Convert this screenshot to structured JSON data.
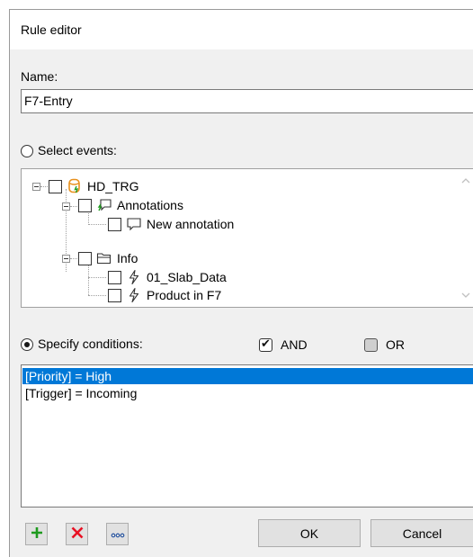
{
  "window": {
    "title": "Rule editor"
  },
  "name_field": {
    "label": "Name:",
    "value": "F7-Entry"
  },
  "select_events": {
    "label": "Select events:",
    "selected": false
  },
  "tree": {
    "root": {
      "label": "HD_TRG",
      "icon": "database-trigger-icon",
      "checked": false
    },
    "groups": [
      {
        "label": "Annotations",
        "icon": "annotation-group-icon",
        "checked": false,
        "children": [
          {
            "label": "New annotation",
            "icon": "comment-icon",
            "checked": false
          }
        ]
      },
      {
        "label": "Info",
        "icon": "folder-icon",
        "checked": false,
        "children": [
          {
            "label": "01_Slab_Data",
            "icon": "lightning-icon",
            "checked": false
          },
          {
            "label": "Product in F7",
            "icon": "lightning-icon",
            "checked": false
          }
        ]
      }
    ]
  },
  "conditions": {
    "label": "Specify conditions:",
    "selected": true,
    "and_label": "AND",
    "and_checked": true,
    "or_label": "OR",
    "or_checked": false,
    "items": [
      "[Priority] = High",
      "[Trigger] = Incoming"
    ],
    "selected_index": 0
  },
  "toolbar": {
    "add_icon": "plus-icon",
    "delete_icon": "x-icon",
    "more_icon": "ellipsis-icon"
  },
  "buttons": {
    "ok": "OK",
    "cancel": "Cancel"
  },
  "colors": {
    "selection": "#0078d7",
    "add_green": "#1e9a1e",
    "delete_red": "#e81123",
    "db_orange": "#e8901c"
  }
}
